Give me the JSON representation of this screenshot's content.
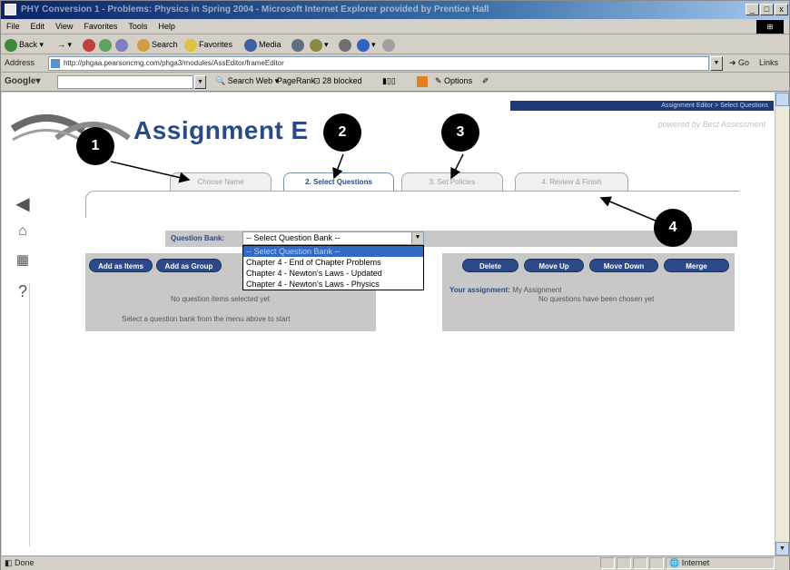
{
  "window": {
    "title": "PHY Conversion 1 - Problems: Physics in Spring 2004 - Microsoft Internet Explorer provided by Prentice Hall",
    "controls": {
      "minimize": "_",
      "maximize": "□",
      "close": "x"
    }
  },
  "menu": {
    "items": [
      "File",
      "Edit",
      "View",
      "Favorites",
      "Tools",
      "Help"
    ]
  },
  "toolbar": {
    "back": "Back",
    "search": "Search",
    "favorites": "Favorites",
    "media": "Media"
  },
  "address": {
    "label": "Address",
    "url": "http://phgaa.pearsoncmg.com/phga3/modules/AssEditor/frameEditor",
    "go": "Go",
    "links": "Links"
  },
  "google": {
    "logo": "Google",
    "search_web": "Search Web",
    "pagerank": "PageRank",
    "blocked": "28 blocked",
    "options": "Options"
  },
  "page": {
    "breadcrumb": "Assignment Editor > Select Questions",
    "brand": "powered by Best Assessment",
    "title": "Assignment E",
    "tabs": [
      {
        "label": "Choose Name",
        "active": false
      },
      {
        "label": "2. Select Questions",
        "active": true
      },
      {
        "label": "3. Set Policies",
        "active": false
      },
      {
        "label": "4. Review & Finish",
        "active": false
      }
    ],
    "question_bank": {
      "label": "Question Bank:",
      "selected": "-- Select Question Bank --",
      "options": [
        "-- Select Question Bank --",
        "Chapter 4 - End of Chapter Problems",
        "Chapter 4 - Newton's Laws - Updated",
        "Chapter 4 - Newton's Laws - Physics"
      ]
    },
    "left_panel": {
      "buttons": [
        "Add as Items",
        "Add as Group"
      ],
      "line1": "No question items selected yet",
      "line2": "Select a question bank from the menu above to start"
    },
    "right_panel": {
      "buttons": [
        "Delete",
        "Move Up",
        "Move Down",
        "Merge"
      ],
      "assignment_label": "Your assignment:",
      "assignment_name": "My Assignment",
      "empty_text": "No questions have been chosen yet"
    }
  },
  "callouts": [
    "1",
    "2",
    "3",
    "4"
  ],
  "status": {
    "left": "Done",
    "zone": "Internet"
  },
  "colors": {
    "title_blue": "#2a4a86",
    "button_navy": "#2c4a8a",
    "panel_gray": "#c8c8c8",
    "titlebar": "#0a246a",
    "dropdown_highlight": "#316ac5"
  }
}
